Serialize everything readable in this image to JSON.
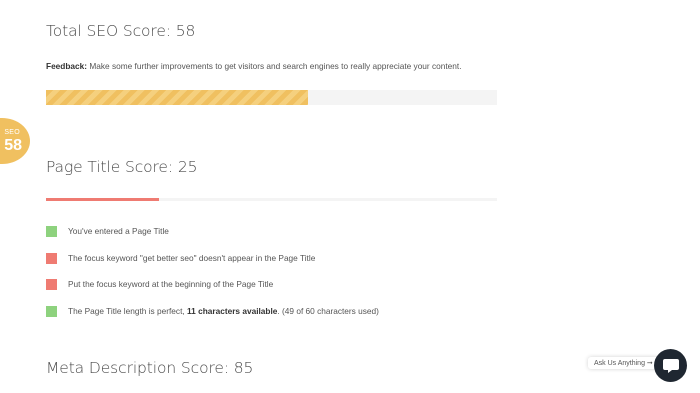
{
  "total": {
    "heading": "Total SEO Score: 58",
    "score_fraction": 0.58,
    "feedback_label": "Feedback:",
    "feedback_text": " Make some further improvements to get visitors and search engines to really appreciate your content."
  },
  "badge": {
    "label": "SEO",
    "value": "58"
  },
  "page_title": {
    "heading": "Page Title Score: 25",
    "score_fraction": 0.25,
    "checks": [
      {
        "status": "pass",
        "text": "You've entered a Page Title"
      },
      {
        "status": "fail",
        "text": "The focus keyword \"get better seo\" doesn't appear in the Page Title"
      },
      {
        "status": "fail",
        "text": "Put the focus keyword at the beginning of the Page Title"
      },
      {
        "status": "pass",
        "text_before": "The Page Title length is perfect, ",
        "text_bold": "11 characters available",
        "text_after": ". (49 of 60 characters used)"
      }
    ]
  },
  "meta": {
    "heading": "Meta Description Score: 85"
  },
  "chat": {
    "ask_label": "Ask Us Anything",
    "arrow": "➞"
  },
  "colors": {
    "pass": "#8ed27e",
    "fail": "#ef7b72",
    "accent": "#f0c060",
    "chat_bg": "#1f2731"
  }
}
